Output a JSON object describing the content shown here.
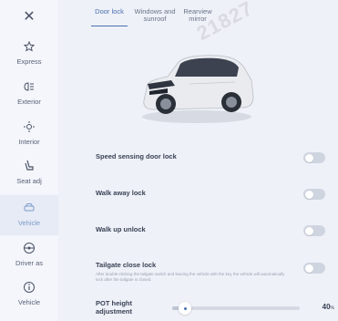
{
  "sidebar": {
    "close_icon": "close-icon",
    "items": [
      {
        "label": "Express",
        "icon": "star-icon"
      },
      {
        "label": "Exterior",
        "icon": "headlight-icon"
      },
      {
        "label": "Interior",
        "icon": "interior-light-icon"
      },
      {
        "label": "Seat adj",
        "icon": "seat-icon"
      },
      {
        "label": "Vehicle",
        "icon": "car-icon",
        "active": true
      },
      {
        "label": "Driver as",
        "icon": "steering-wheel-icon"
      },
      {
        "label": "Vehicle",
        "icon": "info-icon"
      }
    ]
  },
  "tabs": [
    {
      "label": "Door lock",
      "active": true
    },
    {
      "label": "Windows and sunroof"
    },
    {
      "label": "Rearview mirror"
    }
  ],
  "watermark": "21827",
  "settings": [
    {
      "label": "Speed sensing door lock",
      "enabled": false
    },
    {
      "label": "Walk away lock",
      "enabled": false
    },
    {
      "label": "Walk up unlock",
      "enabled": false
    },
    {
      "label": "Tailgate close lock",
      "description": "After double-clicking the tailgate switch and leaving the vehicle with the key the vehicle will automatically lock after the tailgate is closed.",
      "enabled": false
    }
  ],
  "pot_height": {
    "label": "POT height adjustment",
    "value": 40,
    "unit": "%",
    "display": "40"
  },
  "colors": {
    "accent": "#4a6fb0",
    "background": "#eef1f7",
    "toggle_off": "#cfd5e0"
  }
}
